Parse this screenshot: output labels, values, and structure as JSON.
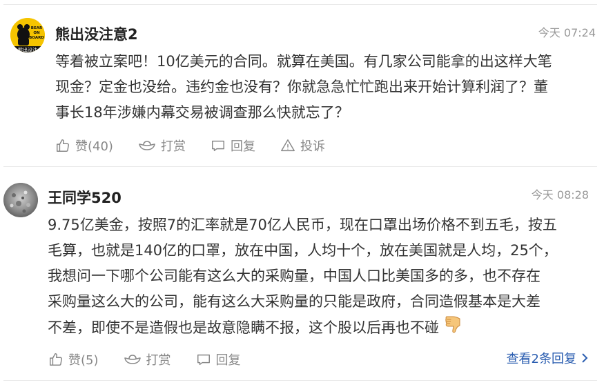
{
  "comments": [
    {
      "username": "熊出没注意2",
      "time": "今天 07:24",
      "avatar_text": [
        "BEAR",
        "ON",
        "BOARD",
        "熊出没注"
      ],
      "lines": [
        "等着被立案吧！10亿美元的合同。就算在美国。有几家公司能拿的出这样大笔",
        "现金？定金也没给。违约金也没有？你就急急忙忙跑出来开始计算利润了？董",
        "事长18年涉嫌内幕交易被调查那么快就忘了？"
      ],
      "actions": {
        "like": "赞(40)",
        "tip": "打赏",
        "reply": "回复",
        "report": "投诉"
      }
    },
    {
      "username": "王同学520",
      "time": "今天 08:28",
      "lines": [
        "9.75亿美金，按照7的汇率就是70亿人民币，现在口罩出场价格不到五毛，按五",
        "毛算，也就是140亿的口罩，放在中国，人均十个，放在美国就是人均，25个，",
        "我想问一下哪个公司能有这么大的采购量，中国人口比美国多的多，也不存在",
        "采购量这么大的公司，能有这么大采购量的只能是政府，合同造假基本是大差",
        "不差，即使不是造假也是故意隐瞒不报，这个股以后再也不碰"
      ],
      "emoji": "thumbs-down",
      "actions": {
        "like": "赞(5)",
        "tip": "打赏",
        "reply": "回复"
      },
      "view_replies": "查看2条回复"
    }
  ],
  "colors": {
    "link": "#2a5db0",
    "muted": "#999999",
    "action": "#888888",
    "avatar_bg": "#f5c400"
  }
}
